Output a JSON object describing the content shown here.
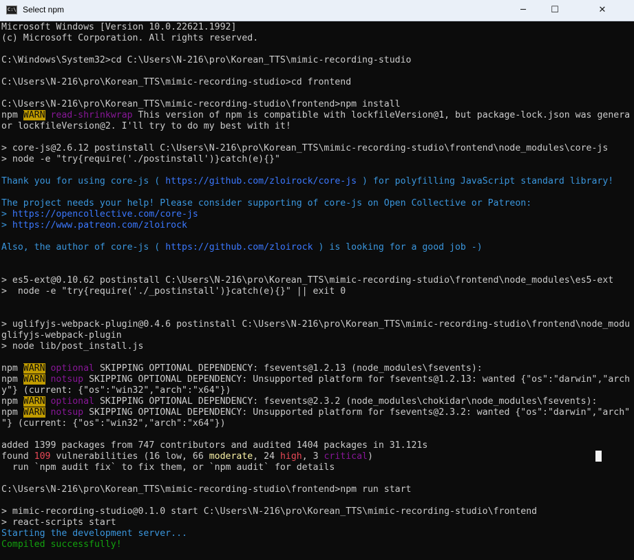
{
  "window": {
    "title": "Select npm",
    "icon_label": "C:\\",
    "minimize_glyph": "─",
    "maximize_glyph": "☐",
    "close_glyph": "✕"
  },
  "colors": {
    "background": "#0c0c0c",
    "text": "#cccccc",
    "warn_bg": "#c19c00",
    "magenta": "#881798",
    "cyan": "#3a96dd",
    "blue": "#3b78ff",
    "green": "#13a10e",
    "red": "#e74856"
  },
  "terminal": {
    "lines": [
      {
        "segments": [
          {
            "t": "Microsoft Windows [Version 10.0.22621.1992]"
          }
        ]
      },
      {
        "segments": [
          {
            "t": "(c) Microsoft Corporation. All rights reserved."
          }
        ]
      },
      {
        "segments": []
      },
      {
        "segments": [
          {
            "t": "C:\\Windows\\System32>cd C:\\Users\\N-216\\pro\\Korean_TTS\\mimic-recording-studio"
          }
        ]
      },
      {
        "segments": []
      },
      {
        "segments": [
          {
            "t": "C:\\Users\\N-216\\pro\\Korean_TTS\\mimic-recording-studio>cd frontend"
          }
        ]
      },
      {
        "segments": []
      },
      {
        "segments": [
          {
            "t": "C:\\Users\\N-216\\pro\\Korean_TTS\\mimic-recording-studio\\frontend>npm install"
          }
        ]
      },
      {
        "segments": [
          {
            "t": "npm "
          },
          {
            "t": "WARN",
            "c": "warn"
          },
          {
            "t": " "
          },
          {
            "t": "read-shrinkwrap",
            "c": "magenta"
          },
          {
            "t": " This version of npm is compatible with lockfileVersion@1, but package-lock.json was genera"
          }
        ]
      },
      {
        "segments": [
          {
            "t": "or lockfileVersion@2. I'll try to do my best with it!"
          }
        ]
      },
      {
        "segments": []
      },
      {
        "segments": [
          {
            "t": "> core-js@2.6.12 postinstall C:\\Users\\N-216\\pro\\Korean_TTS\\mimic-recording-studio\\frontend\\node_modules\\core-js"
          }
        ]
      },
      {
        "segments": [
          {
            "t": "> node -e \"try{require('./postinstall')}catch(e){}\""
          }
        ]
      },
      {
        "segments": []
      },
      {
        "segments": [
          {
            "t": "Thank you for using core-js ( ",
            "c": "cyan"
          },
          {
            "t": "https://github.com/zloirock/core-js",
            "c": "blue"
          },
          {
            "t": " ) for polyfilling JavaScript standard library!",
            "c": "cyan"
          }
        ]
      },
      {
        "segments": []
      },
      {
        "segments": [
          {
            "t": "The project needs your help! Please consider supporting of core-js on Open Collective or Patreon:",
            "c": "cyan"
          }
        ]
      },
      {
        "segments": [
          {
            "t": "> ",
            "c": "cyan"
          },
          {
            "t": "https://opencollective.com/core-js",
            "c": "blue"
          }
        ]
      },
      {
        "segments": [
          {
            "t": "> ",
            "c": "cyan"
          },
          {
            "t": "https://www.patreon.com/zloirock",
            "c": "blue"
          }
        ]
      },
      {
        "segments": []
      },
      {
        "segments": [
          {
            "t": "Also, the author of core-js ( ",
            "c": "cyan"
          },
          {
            "t": "https://github.com/zloirock",
            "c": "blue"
          },
          {
            "t": " ) is looking for a good job -)",
            "c": "cyan"
          }
        ]
      },
      {
        "segments": []
      },
      {
        "segments": []
      },
      {
        "segments": [
          {
            "t": "> es5-ext@0.10.62 postinstall C:\\Users\\N-216\\pro\\Korean_TTS\\mimic-recording-studio\\frontend\\node_modules\\es5-ext"
          }
        ]
      },
      {
        "segments": [
          {
            "t": ">  node -e \"try{require('./_postinstall')}catch(e){}\" || exit 0"
          }
        ]
      },
      {
        "segments": []
      },
      {
        "segments": []
      },
      {
        "segments": [
          {
            "t": "> uglifyjs-webpack-plugin@0.4.6 postinstall C:\\Users\\N-216\\pro\\Korean_TTS\\mimic-recording-studio\\frontend\\node_modu"
          }
        ]
      },
      {
        "segments": [
          {
            "t": "glifyjs-webpack-plugin"
          }
        ]
      },
      {
        "segments": [
          {
            "t": "> node lib/post_install.js"
          }
        ]
      },
      {
        "segments": []
      },
      {
        "segments": [
          {
            "t": "npm "
          },
          {
            "t": "WARN",
            "c": "warn"
          },
          {
            "t": " "
          },
          {
            "t": "optional",
            "c": "magenta"
          },
          {
            "t": " SKIPPING OPTIONAL DEPENDENCY: fsevents@1.2.13 (node_modules\\fsevents):"
          }
        ]
      },
      {
        "segments": [
          {
            "t": "npm "
          },
          {
            "t": "WARN",
            "c": "warn"
          },
          {
            "t": " "
          },
          {
            "t": "notsup",
            "c": "magenta"
          },
          {
            "t": " SKIPPING OPTIONAL DEPENDENCY: Unsupported platform for fsevents@1.2.13: wanted {\"os\":\"darwin\",\"arch"
          }
        ]
      },
      {
        "segments": [
          {
            "t": "y\"} (current: {\"os\":\"win32\",\"arch\":\"x64\"})"
          }
        ]
      },
      {
        "segments": [
          {
            "t": "npm "
          },
          {
            "t": "WARN",
            "c": "warn"
          },
          {
            "t": " "
          },
          {
            "t": "optional",
            "c": "magenta"
          },
          {
            "t": " SKIPPING OPTIONAL DEPENDENCY: fsevents@2.3.2 (node_modules\\chokidar\\node_modules\\fsevents):"
          }
        ]
      },
      {
        "segments": [
          {
            "t": "npm "
          },
          {
            "t": "WARN",
            "c": "warn"
          },
          {
            "t": " "
          },
          {
            "t": "notsup",
            "c": "magenta"
          },
          {
            "t": " SKIPPING OPTIONAL DEPENDENCY: Unsupported platform for fsevents@2.3.2: wanted {\"os\":\"darwin\",\"arch\""
          }
        ]
      },
      {
        "segments": [
          {
            "t": "\"} (current: {\"os\":\"win32\",\"arch\":\"x64\"})"
          }
        ]
      },
      {
        "segments": []
      },
      {
        "segments": [
          {
            "t": "added 1399 packages from 747 contributors and audited 1404 packages in 31.121s"
          }
        ]
      },
      {
        "segments": [
          {
            "t": "found "
          },
          {
            "t": "109",
            "c": "red"
          },
          {
            "t": " vulnerabilities (16 low, 66 "
          },
          {
            "t": "moderate",
            "c": "yellow"
          },
          {
            "t": ", 24 "
          },
          {
            "t": "high",
            "c": "red"
          },
          {
            "t": ", 3 "
          },
          {
            "t": "critical",
            "c": "magenta"
          },
          {
            "t": ")"
          }
        ]
      },
      {
        "segments": [
          {
            "t": "  run `npm audit fix` to fix them, or `npm audit` for details"
          }
        ]
      },
      {
        "segments": []
      },
      {
        "segments": [
          {
            "t": "C:\\Users\\N-216\\pro\\Korean_TTS\\mimic-recording-studio\\frontend>npm run start"
          }
        ]
      },
      {
        "segments": []
      },
      {
        "segments": [
          {
            "t": "> mimic-recording-studio@0.1.0 start C:\\Users\\N-216\\pro\\Korean_TTS\\mimic-recording-studio\\frontend"
          }
        ]
      },
      {
        "segments": [
          {
            "t": "> react-scripts start"
          }
        ]
      },
      {
        "segments": [
          {
            "t": "Starting the development server...",
            "c": "cyan"
          }
        ]
      },
      {
        "segments": [
          {
            "t": "Compiled successfully!",
            "c": "green"
          }
        ]
      }
    ]
  }
}
